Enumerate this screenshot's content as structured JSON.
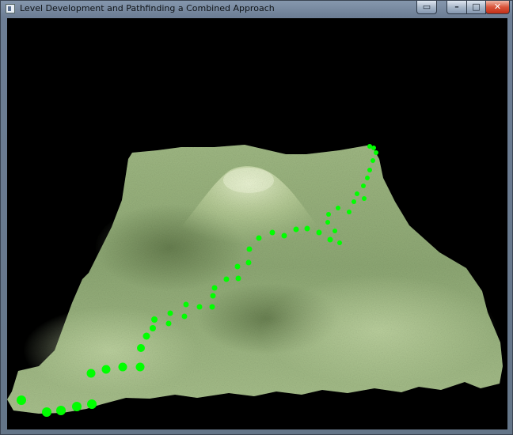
{
  "window": {
    "title": "Level Development and Pathfinding a Combined Approach",
    "icons": {
      "app": "app-window-icon",
      "extra": "window-layout-icon",
      "minimize": "minimize-icon",
      "maximize": "maximize-icon",
      "close": "close-icon"
    },
    "glyphs": {
      "extra": "▭",
      "minimize": "–",
      "maximize": "□",
      "close": "✕"
    }
  },
  "scene": {
    "background": "#000000",
    "terrain_color": "#a9c48a",
    "path_color": "#00ff00"
  }
}
